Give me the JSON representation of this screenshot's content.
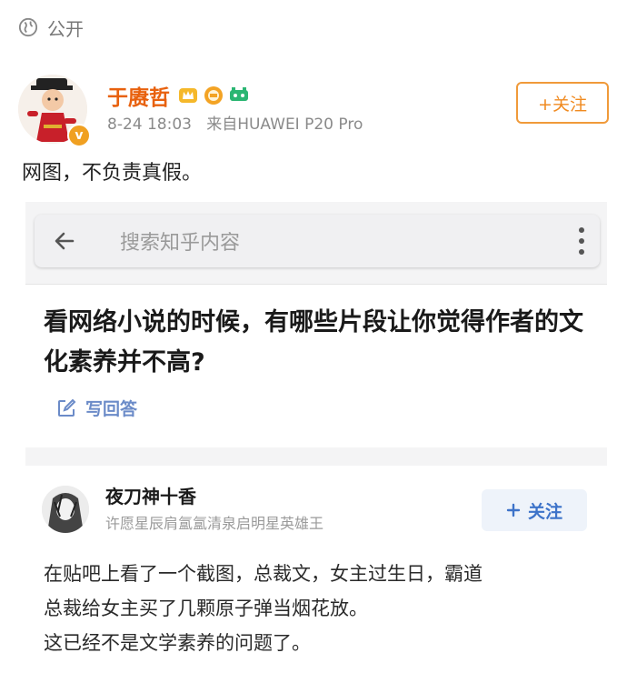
{
  "visibility": {
    "label": "公开",
    "icon": "globe-icon"
  },
  "post": {
    "author": "于赓哲",
    "timestamp": "8-24 18:03",
    "source_prefix": "来自",
    "source_device": "HUAWEI P20 Pro",
    "follow_label": "+关注",
    "text": "网图，不负责真假。",
    "verified_badge": "v",
    "colors": {
      "author": "#e8610e",
      "follow_border": "#f09a3a"
    }
  },
  "screenshot": {
    "search_placeholder": "搜索知乎内容",
    "question": "看网络小说的时候，有哪些片段让你觉得作者的文化素养并不高?",
    "write_answer_label": "写回答",
    "answer": {
      "author": "夜刀神十香",
      "bio": "许愿星辰肩氲氲清泉启明星英雄王",
      "follow_label": "关注",
      "body_lines": [
        "在贴吧上看了一个截图，总裁文，女主过生日，霸道",
        "总裁给女主买了几颗原子弹当烟花放。",
        "这已经不是文学素养的问题了。"
      ]
    }
  }
}
